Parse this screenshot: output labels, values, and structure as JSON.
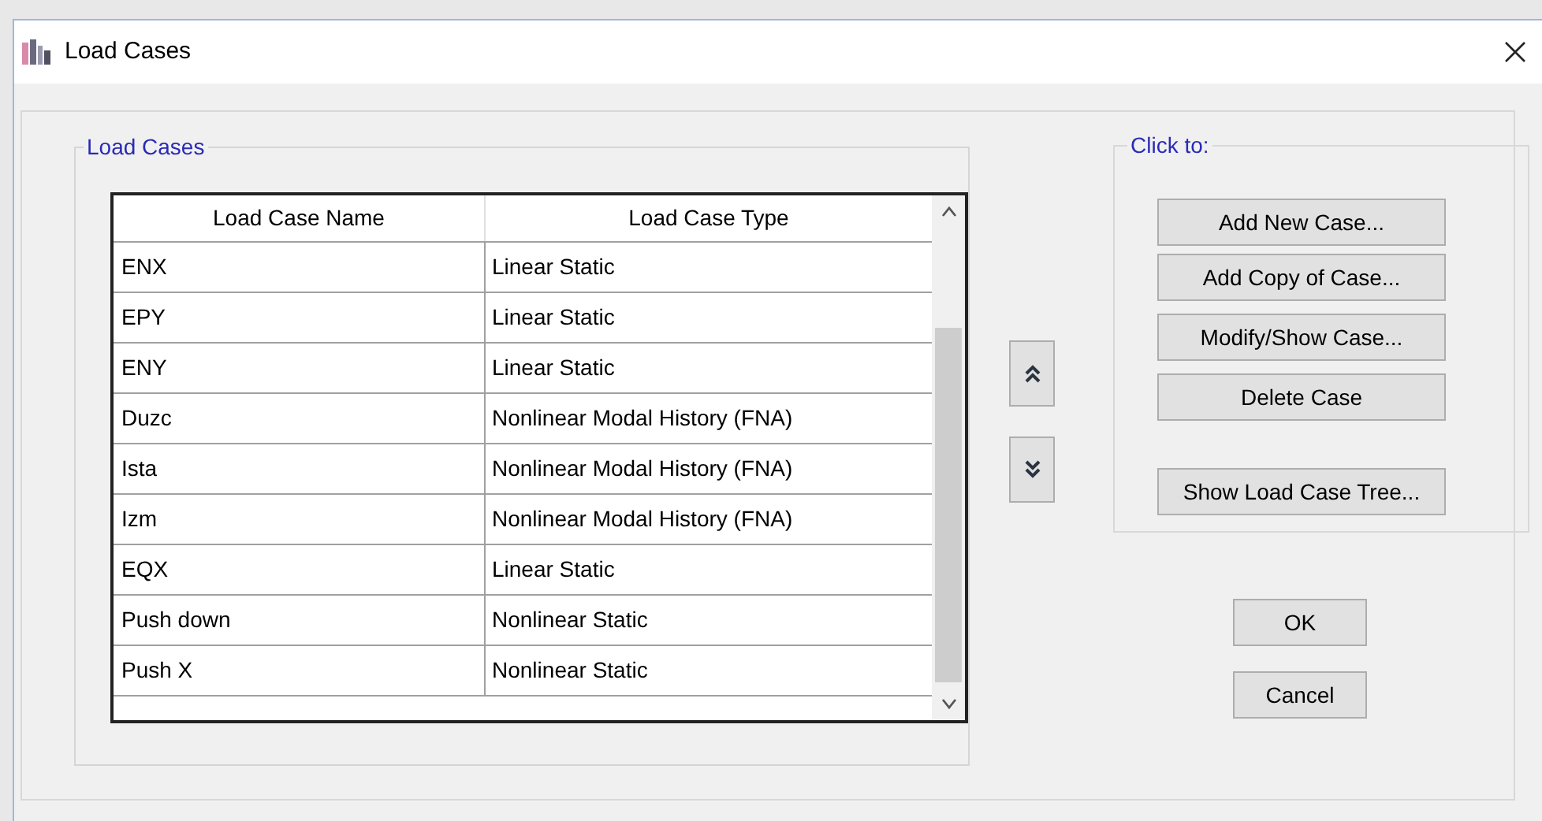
{
  "window": {
    "title": "Load Cases"
  },
  "load_cases_group": {
    "title": "Load Cases",
    "table": {
      "columns": [
        "Load Case Name",
        "Load Case Type"
      ],
      "rows": [
        {
          "name": "ENX",
          "type": "Linear Static"
        },
        {
          "name": "EPY",
          "type": "Linear Static"
        },
        {
          "name": "ENY",
          "type": "Linear Static"
        },
        {
          "name": "Duzc",
          "type": "Nonlinear Modal History (FNA)"
        },
        {
          "name": "Ista",
          "type": "Nonlinear Modal History (FNA)"
        },
        {
          "name": "Izm",
          "type": "Nonlinear Modal History (FNA)"
        },
        {
          "name": "EQX",
          "type": "Linear Static"
        },
        {
          "name": "Push down",
          "type": "Nonlinear Static"
        },
        {
          "name": "Push X",
          "type": "Nonlinear Static"
        }
      ]
    }
  },
  "click_to_group": {
    "title": "Click to:",
    "buttons": [
      "Add New Case...",
      "Add Copy of Case...",
      "Modify/Show Case...",
      "Delete Case",
      "Show Load Case Tree..."
    ]
  },
  "buttons": [
    "OK",
    "Cancel"
  ]
}
